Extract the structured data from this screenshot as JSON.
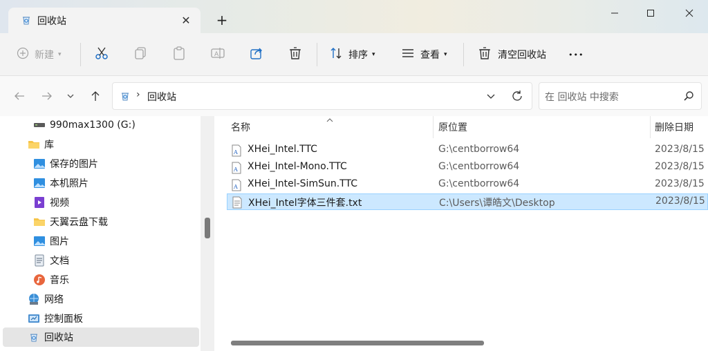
{
  "tab": {
    "title": "回收站"
  },
  "window_controls": {
    "minimize": "—",
    "maximize": "☐",
    "close": "✕"
  },
  "toolbar": {
    "new_label": "新建",
    "sort_label": "排序",
    "view_label": "查看",
    "empty_bin_label": "清空回收站",
    "more_label": "•••"
  },
  "address": {
    "breadcrumb": "回收站",
    "search_placeholder": "在 回收站 中搜索"
  },
  "sidebar": {
    "items": [
      {
        "label": "990max1300 (G:)",
        "icon": "drive-icon"
      },
      {
        "label": "库",
        "icon": "folder-icon"
      },
      {
        "label": "保存的图片",
        "icon": "pictures-icon"
      },
      {
        "label": "本机照片",
        "icon": "pictures-icon"
      },
      {
        "label": "视频",
        "icon": "video-icon"
      },
      {
        "label": "天翼云盘下载",
        "icon": "folder-icon"
      },
      {
        "label": "图片",
        "icon": "pictures-icon"
      },
      {
        "label": "文档",
        "icon": "documents-icon"
      },
      {
        "label": "音乐",
        "icon": "music-icon"
      },
      {
        "label": "网络",
        "icon": "network-icon"
      },
      {
        "label": "控制面板",
        "icon": "control-panel-icon"
      },
      {
        "label": "回收站",
        "icon": "recycle-bin-icon"
      }
    ]
  },
  "columns": {
    "name": "名称",
    "location": "原位置",
    "date": "删除日期"
  },
  "files": [
    {
      "name": "XHei_Intel.TTC",
      "location": "G:\\centborrow64",
      "date": "2023/8/15",
      "type": "font"
    },
    {
      "name": "XHei_Intel-Mono.TTC",
      "location": "G:\\centborrow64",
      "date": "2023/8/15",
      "type": "font"
    },
    {
      "name": "XHei_Intel-SimSun.TTC",
      "location": "G:\\centborrow64",
      "date": "2023/8/15",
      "type": "font"
    },
    {
      "name": "XHei_Intel字体三件套.txt",
      "location": "C:\\Users\\谭皓文\\Desktop",
      "date": "2023/8/15",
      "type": "text"
    }
  ],
  "colors": {
    "accent": "#0067c0",
    "selected_row": "#cce8ff",
    "selected_border": "#99d1ff"
  }
}
